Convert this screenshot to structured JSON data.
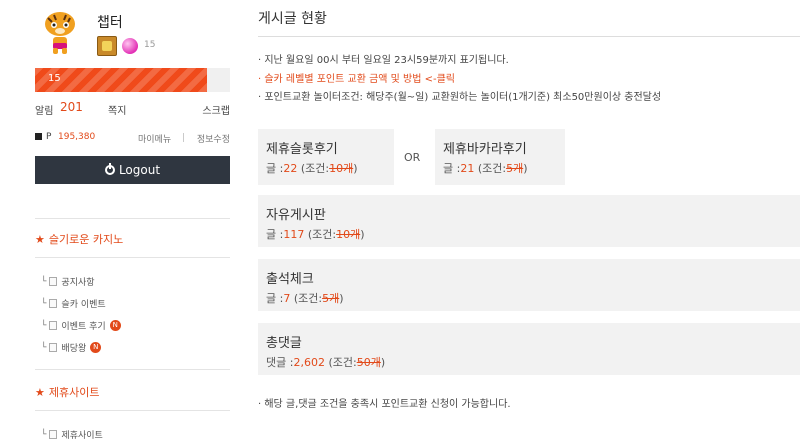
{
  "profile": {
    "nickname": "챕터",
    "level": "15",
    "xp_fraction": 0.88
  },
  "xp_bar": {
    "label": "15"
  },
  "stats": {
    "alarm_label": "알림",
    "alarm_count": "201",
    "memo_label": "쪽지",
    "scrap_label": "스크랩"
  },
  "points": {
    "label": "P",
    "value": "195,380",
    "my_menu": "마이메뉴",
    "divider": "|",
    "edit_info": "정보수정"
  },
  "logout": {
    "label": "Logout"
  },
  "sections": [
    {
      "title": "슬기로운 카지노",
      "items": [
        {
          "label": "공지사항",
          "badge": ""
        },
        {
          "label": "슬카 이벤트",
          "badge": ""
        },
        {
          "label": "이벤트 후기",
          "badge": "N"
        },
        {
          "label": "배당왕",
          "badge": "N"
        }
      ]
    },
    {
      "title": "제휴사이트",
      "items": [
        {
          "label": "제휴사이트",
          "badge": ""
        }
      ]
    }
  ],
  "main": {
    "title": "게시글 현황",
    "info_lines": [
      "· 지난 월요일 00시 부터 일요일 23시59분까지 표기됩니다.",
      "· 슬카 레벨별 포인트 교환 금액 및 방법 <-클릭",
      "· 포인트교환 놀이터조건: 해당주(월~일) 교환원하는 놀이터(1개기준) 최소50만원이상 충전달성"
    ],
    "or_label": "OR",
    "boards": [
      {
        "title": "제휴슬롯후기",
        "count_prefix": "글 :",
        "count": "22",
        "cond_prefix": "(조건:",
        "cond": "10개",
        "cond_suffix": ")"
      },
      {
        "title": "제휴바카라후기",
        "count_prefix": "글 :",
        "count": "21",
        "cond_prefix": "(조건:",
        "cond": "5개",
        "cond_suffix": ")"
      },
      {
        "title": "자유게시판",
        "count_prefix": "글 :",
        "count": "117",
        "cond_prefix": "(조건:",
        "cond": "10개",
        "cond_suffix": ")"
      },
      {
        "title": "출석체크",
        "count_prefix": "글 :",
        "count": "7",
        "cond_prefix": "(조건:",
        "cond": "5개",
        "cond_suffix": ")"
      },
      {
        "title": "총댓글",
        "count_prefix": "댓글 :",
        "count": "2,602",
        "cond_prefix": "(조건:",
        "cond": "50개",
        "cond_suffix": ")"
      }
    ],
    "footer_note": "· 해당 글,댓글 조건을 충족시 포인트교환 신청이 가능합니다."
  },
  "colors": {
    "accent": "#e24a1a",
    "logout_bg": "#2f3640",
    "box_bg": "#f2f2f2"
  }
}
